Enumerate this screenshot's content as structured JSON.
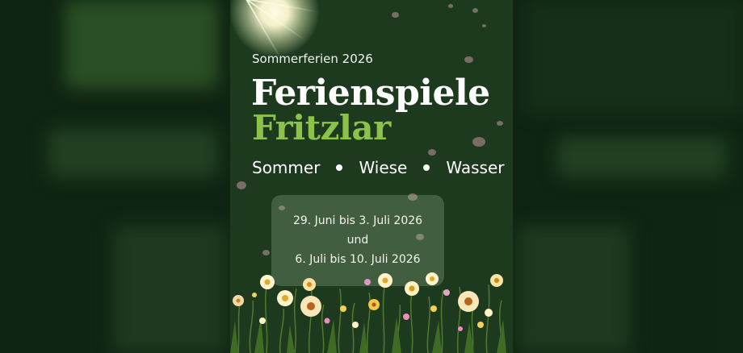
{
  "poster": {
    "subtitle": "Sommerferien 2026",
    "title_line1": "Ferienspiele",
    "title_line2": "Fritzlar",
    "tagline": [
      "Sommer",
      "Wiese",
      "Wasser"
    ],
    "dates": {
      "line1": "29. Juni bis 3. Juli 2026",
      "line2": "und",
      "line3": "6. Juli bis 10. Juli 2026"
    }
  },
  "colors": {
    "background": "#1d3a1f",
    "accent_green": "#8bc34a",
    "text": "#ffffff"
  }
}
